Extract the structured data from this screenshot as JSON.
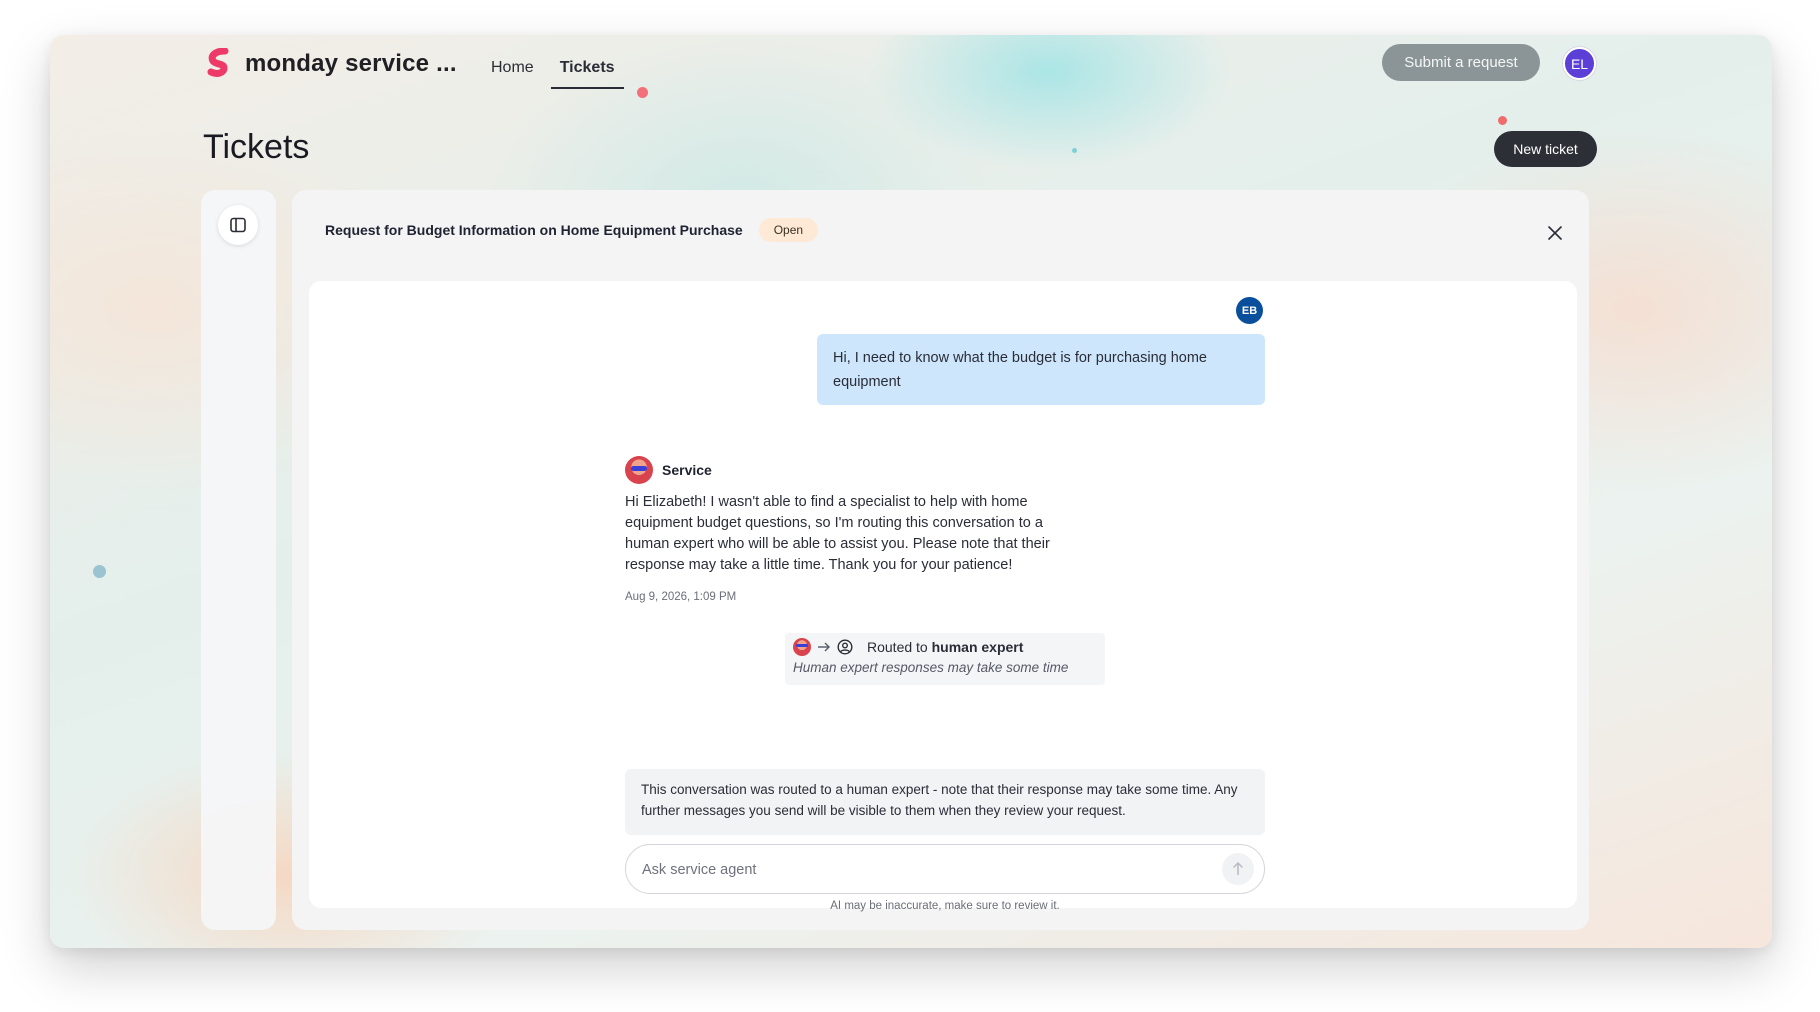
{
  "app": {
    "brand_name": "monday service ...",
    "brand_color": "#ee3a68"
  },
  "nav": {
    "items": [
      {
        "label": "Home",
        "active": false
      },
      {
        "label": "Tickets",
        "active": true
      }
    ]
  },
  "header": {
    "submit_label": "Submit a request",
    "user_initials": "EL",
    "user_avatar_color": "#5b3fd6"
  },
  "page": {
    "title": "Tickets",
    "new_ticket_label": "New ticket"
  },
  "sidebar": {
    "toggle_icon": "sidebar-panel-icon"
  },
  "ticket": {
    "title": "Request for Budget Information on Home Equipment Purchase",
    "status": "Open",
    "close_icon": "close-icon"
  },
  "conversation": {
    "user_initials": "EB",
    "user_message": "Hi, I need to know what the budget is for purchasing home equipment",
    "agent_name": "Service",
    "agent_message": "Hi Elizabeth! I wasn't able to find a specialist to help with home equipment budget questions, so I'm routing this conversation to a human expert who will be able to assist you. Please note that their response may take a little time. Thank you for your patience!",
    "agent_timestamp": "Aug 9, 2026, 1:09 PM",
    "routed_prefix": "Routed to ",
    "routed_target": "human expert",
    "routed_note": "Human expert responses may take some time",
    "notice": "This conversation was routed to a human expert - note that their response may take some time. Any further messages you send will be visible to them when they review your request."
  },
  "composer": {
    "placeholder": "Ask service agent",
    "value": "",
    "send_icon": "arrow-up-icon",
    "disclaimer": "AI may be inaccurate, make sure to review it."
  }
}
